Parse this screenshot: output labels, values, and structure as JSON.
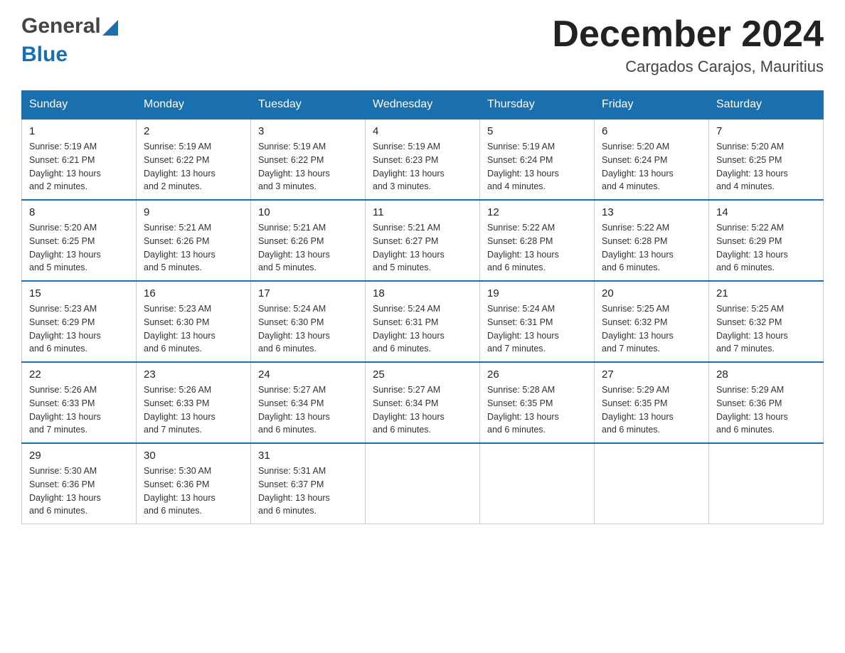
{
  "logo": {
    "general": "General",
    "blue": "Blue"
  },
  "title": {
    "month": "December 2024",
    "location": "Cargados Carajos, Mauritius"
  },
  "weekdays": [
    "Sunday",
    "Monday",
    "Tuesday",
    "Wednesday",
    "Thursday",
    "Friday",
    "Saturday"
  ],
  "weeks": [
    [
      {
        "day": "1",
        "sunrise": "5:19 AM",
        "sunset": "6:21 PM",
        "daylight": "13 hours and 2 minutes."
      },
      {
        "day": "2",
        "sunrise": "5:19 AM",
        "sunset": "6:22 PM",
        "daylight": "13 hours and 2 minutes."
      },
      {
        "day": "3",
        "sunrise": "5:19 AM",
        "sunset": "6:22 PM",
        "daylight": "13 hours and 3 minutes."
      },
      {
        "day": "4",
        "sunrise": "5:19 AM",
        "sunset": "6:23 PM",
        "daylight": "13 hours and 3 minutes."
      },
      {
        "day": "5",
        "sunrise": "5:19 AM",
        "sunset": "6:24 PM",
        "daylight": "13 hours and 4 minutes."
      },
      {
        "day": "6",
        "sunrise": "5:20 AM",
        "sunset": "6:24 PM",
        "daylight": "13 hours and 4 minutes."
      },
      {
        "day": "7",
        "sunrise": "5:20 AM",
        "sunset": "6:25 PM",
        "daylight": "13 hours and 4 minutes."
      }
    ],
    [
      {
        "day": "8",
        "sunrise": "5:20 AM",
        "sunset": "6:25 PM",
        "daylight": "13 hours and 5 minutes."
      },
      {
        "day": "9",
        "sunrise": "5:21 AM",
        "sunset": "6:26 PM",
        "daylight": "13 hours and 5 minutes."
      },
      {
        "day": "10",
        "sunrise": "5:21 AM",
        "sunset": "6:26 PM",
        "daylight": "13 hours and 5 minutes."
      },
      {
        "day": "11",
        "sunrise": "5:21 AM",
        "sunset": "6:27 PM",
        "daylight": "13 hours and 5 minutes."
      },
      {
        "day": "12",
        "sunrise": "5:22 AM",
        "sunset": "6:28 PM",
        "daylight": "13 hours and 6 minutes."
      },
      {
        "day": "13",
        "sunrise": "5:22 AM",
        "sunset": "6:28 PM",
        "daylight": "13 hours and 6 minutes."
      },
      {
        "day": "14",
        "sunrise": "5:22 AM",
        "sunset": "6:29 PM",
        "daylight": "13 hours and 6 minutes."
      }
    ],
    [
      {
        "day": "15",
        "sunrise": "5:23 AM",
        "sunset": "6:29 PM",
        "daylight": "13 hours and 6 minutes."
      },
      {
        "day": "16",
        "sunrise": "5:23 AM",
        "sunset": "6:30 PM",
        "daylight": "13 hours and 6 minutes."
      },
      {
        "day": "17",
        "sunrise": "5:24 AM",
        "sunset": "6:30 PM",
        "daylight": "13 hours and 6 minutes."
      },
      {
        "day": "18",
        "sunrise": "5:24 AM",
        "sunset": "6:31 PM",
        "daylight": "13 hours and 6 minutes."
      },
      {
        "day": "19",
        "sunrise": "5:24 AM",
        "sunset": "6:31 PM",
        "daylight": "13 hours and 7 minutes."
      },
      {
        "day": "20",
        "sunrise": "5:25 AM",
        "sunset": "6:32 PM",
        "daylight": "13 hours and 7 minutes."
      },
      {
        "day": "21",
        "sunrise": "5:25 AM",
        "sunset": "6:32 PM",
        "daylight": "13 hours and 7 minutes."
      }
    ],
    [
      {
        "day": "22",
        "sunrise": "5:26 AM",
        "sunset": "6:33 PM",
        "daylight": "13 hours and 7 minutes."
      },
      {
        "day": "23",
        "sunrise": "5:26 AM",
        "sunset": "6:33 PM",
        "daylight": "13 hours and 7 minutes."
      },
      {
        "day": "24",
        "sunrise": "5:27 AM",
        "sunset": "6:34 PM",
        "daylight": "13 hours and 6 minutes."
      },
      {
        "day": "25",
        "sunrise": "5:27 AM",
        "sunset": "6:34 PM",
        "daylight": "13 hours and 6 minutes."
      },
      {
        "day": "26",
        "sunrise": "5:28 AM",
        "sunset": "6:35 PM",
        "daylight": "13 hours and 6 minutes."
      },
      {
        "day": "27",
        "sunrise": "5:29 AM",
        "sunset": "6:35 PM",
        "daylight": "13 hours and 6 minutes."
      },
      {
        "day": "28",
        "sunrise": "5:29 AM",
        "sunset": "6:36 PM",
        "daylight": "13 hours and 6 minutes."
      }
    ],
    [
      {
        "day": "29",
        "sunrise": "5:30 AM",
        "sunset": "6:36 PM",
        "daylight": "13 hours and 6 minutes."
      },
      {
        "day": "30",
        "sunrise": "5:30 AM",
        "sunset": "6:36 PM",
        "daylight": "13 hours and 6 minutes."
      },
      {
        "day": "31",
        "sunrise": "5:31 AM",
        "sunset": "6:37 PM",
        "daylight": "13 hours and 6 minutes."
      },
      null,
      null,
      null,
      null
    ]
  ],
  "labels": {
    "sunrise": "Sunrise:",
    "sunset": "Sunset:",
    "daylight": "Daylight:"
  }
}
